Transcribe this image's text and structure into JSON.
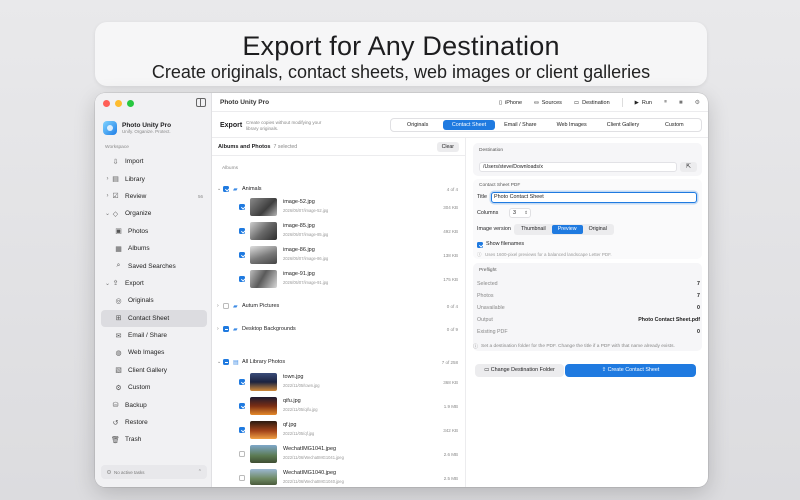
{
  "banner": {
    "headline": "Export for Any Destination",
    "subheadline": "Create originals, contact sheets, web images or client galleries"
  },
  "app": {
    "title": "Photo Unity Pro",
    "name": "Photo Unity Pro",
    "tagline": "Unify. Organize. Protect."
  },
  "toolbar": {
    "iphone": "iPhone",
    "sources": "Sources",
    "destination": "Destination",
    "run": "Run"
  },
  "sidebar": {
    "section": "Workspace",
    "items": [
      {
        "label": "Import",
        "icon": "import-icon"
      },
      {
        "label": "Library",
        "icon": "library-icon"
      },
      {
        "label": "Review",
        "icon": "review-icon",
        "count": "56"
      },
      {
        "label": "Organize",
        "icon": "tag-icon"
      },
      {
        "label": "Photos",
        "icon": "photos-icon"
      },
      {
        "label": "Albums",
        "icon": "albums-icon"
      },
      {
        "label": "Saved Searches",
        "icon": "search-icon"
      },
      {
        "label": "Export",
        "icon": "export-icon"
      },
      {
        "label": "Originals",
        "icon": "originals-icon"
      },
      {
        "label": "Contact Sheet",
        "icon": "grid-icon"
      },
      {
        "label": "Email / Share",
        "icon": "mail-icon"
      },
      {
        "label": "Web Images",
        "icon": "globe-icon"
      },
      {
        "label": "Client Gallery",
        "icon": "gallery-icon"
      },
      {
        "label": "Custom",
        "icon": "custom-icon"
      },
      {
        "label": "Backup",
        "icon": "backup-icon"
      },
      {
        "label": "Restore",
        "icon": "restore-icon"
      },
      {
        "label": "Trash",
        "icon": "trash-icon"
      }
    ],
    "footer": "No active tasks"
  },
  "export_mode": {
    "title": "Export",
    "description": "Create copies without modifying your library originals.",
    "tabs": [
      "Originals",
      "Contact Sheet",
      "Email / Share",
      "Web Images",
      "Client Gallery",
      "Custom"
    ],
    "active_tab": "Contact Sheet"
  },
  "list": {
    "header": "Albums and Photos",
    "selected": "7 selected",
    "clear": "Clear",
    "albums_label": "Albums",
    "groups": [
      {
        "name": "Animals",
        "count": "4 of 4",
        "files": [
          {
            "name": "image-52.jpg",
            "path": "2026/05/07/image-52.jpg",
            "size": "304 KB"
          },
          {
            "name": "image-85.jpg",
            "path": "2026/05/07/image-85.jpg",
            "size": "492 KB"
          },
          {
            "name": "image-86.jpg",
            "path": "2026/05/07/image-86.jpg",
            "size": "138 KB"
          },
          {
            "name": "image-91.jpg",
            "path": "2026/05/07/image-91.jpg",
            "size": "175 KB"
          }
        ]
      },
      {
        "name": "Autum Pictures",
        "count": "0 of 4"
      },
      {
        "name": "Desktop Backgrounds",
        "count": "0 of 9"
      },
      {
        "name": "All Library Photos",
        "count": "7 of 258",
        "files": [
          {
            "name": "town.jpg",
            "path": "2022/11/05/town.jpg",
            "size": "368 KB"
          },
          {
            "name": "qifu.jpg",
            "path": "2022/11/05/qifu.jpg",
            "size": "1.9 MB"
          },
          {
            "name": "qf.jpg",
            "path": "2022/11/05/qf.jpg",
            "size": "342 KB"
          },
          {
            "name": "WechatIMG1041.jpeg",
            "path": "2022/11/06/WechatIMG1041.jpeg",
            "size": "2.6 MB"
          },
          {
            "name": "WechatIMG1040.jpeg",
            "path": "2022/11/06/WechatIMG1040.jpeg",
            "size": "2.5 MB"
          }
        ]
      }
    ]
  },
  "settings": {
    "destination_label": "Destination",
    "destination_path": "/Users/steve/Downloads/x",
    "pdf_label": "Contact Sheet PDF",
    "title_label": "Title",
    "title_value": "Photo Contact Sheet",
    "columns_label": "Columns",
    "columns_value": "3",
    "image_version_label": "Image version",
    "image_versions": [
      "Thumbnail",
      "Preview",
      "Original"
    ],
    "active_version": "Preview",
    "show_filenames": "Show filenames",
    "hint": "Uses 1600-pixel previews for a balanced landscape Letter PDF.",
    "preflight_label": "Preflight",
    "preflight": [
      {
        "k": "Selected",
        "v": "7"
      },
      {
        "k": "Photos",
        "v": "7"
      },
      {
        "k": "Unavailable",
        "v": "0"
      },
      {
        "k": "Output",
        "v": "Photo Contact Sheet.pdf"
      },
      {
        "k": "Existing PDF",
        "v": "0"
      }
    ],
    "note": "Set a destination folder for the PDF. Change the title if a PDF with that name already exists.",
    "change_btn": "Change Destination Folder",
    "create_btn": "Create Contact Sheet"
  },
  "colors": {
    "accent": "#1f7ae0",
    "folder": "#3d8be5"
  }
}
